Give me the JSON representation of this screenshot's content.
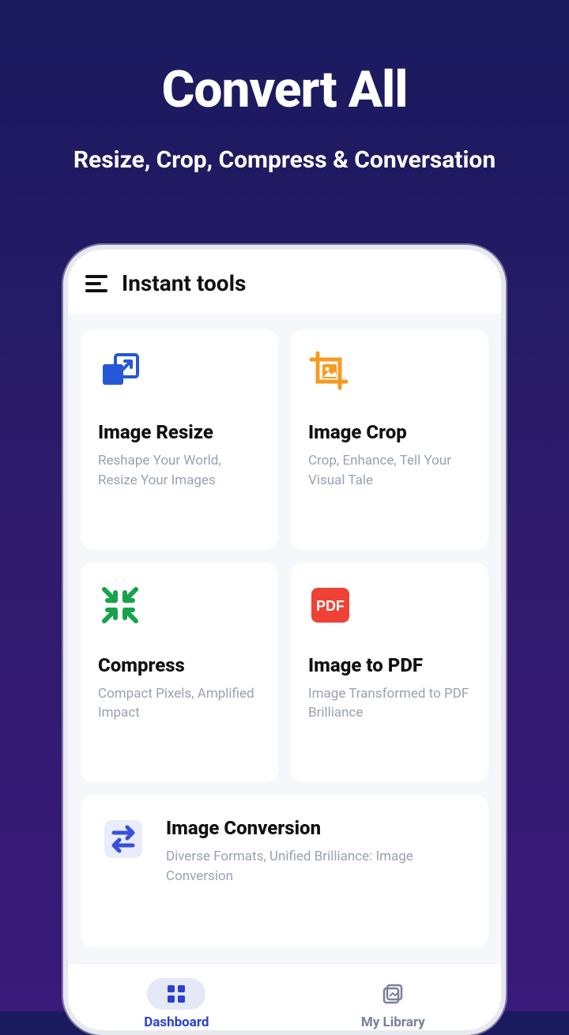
{
  "hero": {
    "title": "Convert All",
    "subtitle": "Resize, Crop, Compress & Conversation"
  },
  "appbar": {
    "title": "Instant tools"
  },
  "tools": [
    {
      "title": "Image Resize",
      "desc": "Reshape Your World, Resize Your Images"
    },
    {
      "title": "Image Crop",
      "desc": "Crop, Enhance, Tell Your Visual Tale"
    },
    {
      "title": "Compress",
      "desc": "Compact Pixels, Amplified Impact"
    },
    {
      "title": "Image to PDF",
      "desc": "Image Transformed to PDF Brilliance"
    },
    {
      "title": "Image Conversion",
      "desc": "Diverse Formats, Unified Brilliance: Image Conversion"
    }
  ],
  "nav": {
    "dashboard": "Dashboard",
    "library": "My Library"
  },
  "colors": {
    "resize": "#2557d6",
    "crop": "#f59b22",
    "compress": "#16a34a",
    "pdf": "#ef4136",
    "convert": "#3a4fd8"
  }
}
